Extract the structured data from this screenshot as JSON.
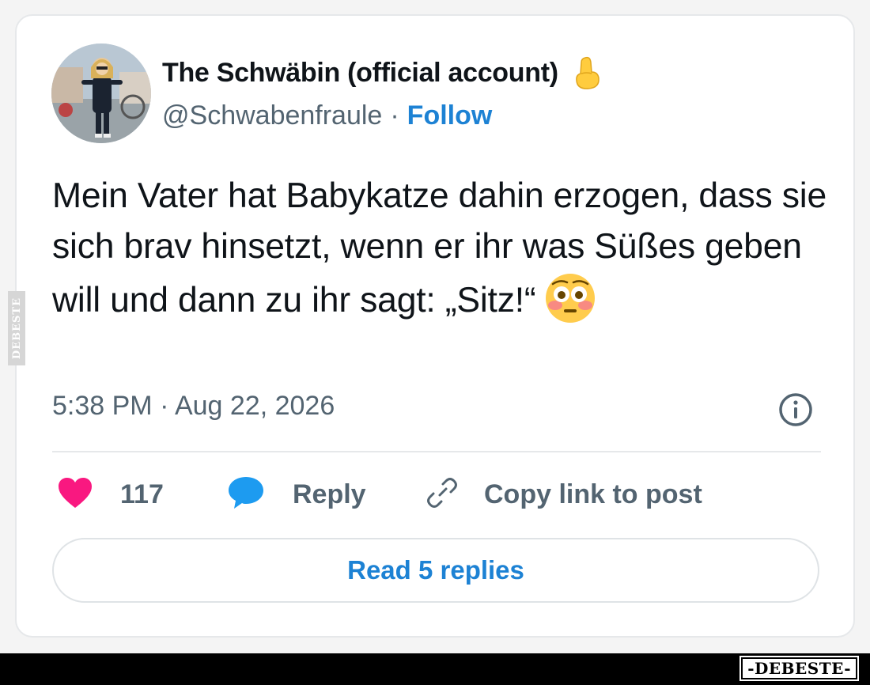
{
  "author": {
    "display_name": "The Schwäbin (official account)",
    "name_emoji": "pinched-fingers-emoji",
    "handle": "@Schwabenfraule",
    "separator": "·",
    "follow_label": "Follow"
  },
  "tweet": {
    "text": "Mein Vater hat Babykatze dahin erzogen, dass sie sich brav hinsetzt, wenn er ihr was Süßes geben will und dann zu ihr sagt: „Sitz!“",
    "emoji": "flushed-face-emoji",
    "timestamp": "5:38 PM · Aug 22, 2026"
  },
  "actions": {
    "like_count": "117",
    "reply_label": "Reply",
    "copy_label": "Copy link to post"
  },
  "read_replies_label": "Read 5 replies",
  "watermark": {
    "side": "DEBESTE",
    "logo": "-DEBESTE-"
  },
  "colors": {
    "accent": "#1d82d4",
    "like": "#f91880",
    "reply_bubble": "#1d9bf0",
    "text": "#0f1419",
    "muted": "#536471"
  }
}
